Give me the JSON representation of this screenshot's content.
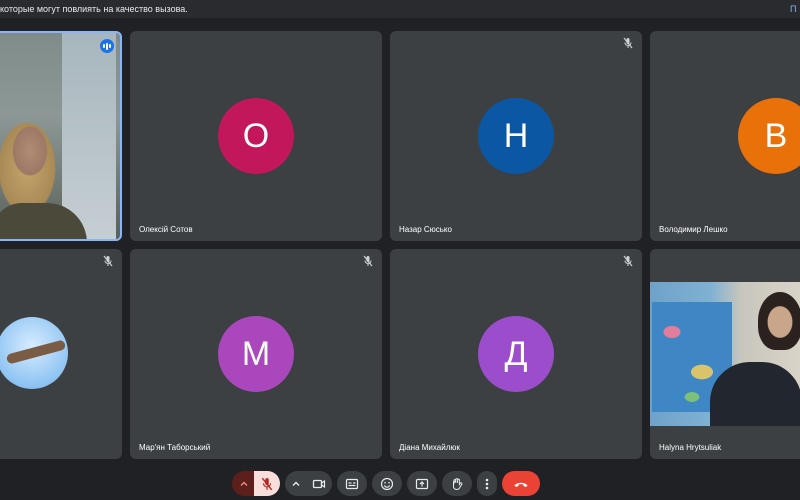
{
  "notification": {
    "text": "которые могут повлиять на качество вызова.",
    "link": "П"
  },
  "participants": [
    {
      "name": "",
      "video": true,
      "speaking": true
    },
    {
      "name": "Олексій Сотов",
      "initial": "О",
      "color": "#c2185b"
    },
    {
      "name": "Назар Сюсько",
      "initial": "Н",
      "color": "#0b57a4",
      "muted": true
    },
    {
      "name": "Володимир Лешко",
      "initial": "В",
      "color": "#e8710a"
    },
    {
      "name": "",
      "muted": true,
      "bird_avatar": true
    },
    {
      "name": "Мар'ян Таборський",
      "initial": "М",
      "color": "#ab47bc",
      "muted": true
    },
    {
      "name": "Діана Михайлюк",
      "initial": "Д",
      "color": "#9c4dcc",
      "muted": true
    },
    {
      "name": "Halyna Hrytsuliak",
      "video": true
    }
  ],
  "controls": [
    {
      "name": "mic-options-chevron",
      "icon": "chevron-up-icon"
    },
    {
      "name": "microphone-toggle",
      "icon": "mic-off-icon",
      "state": "off"
    },
    {
      "name": "camera-options-chevron",
      "icon": "chevron-up-icon"
    },
    {
      "name": "camera-toggle",
      "icon": "video-icon"
    },
    {
      "name": "captions-button",
      "icon": "captions-icon"
    },
    {
      "name": "reactions-button",
      "icon": "emoji-icon"
    },
    {
      "name": "present-button",
      "icon": "present-icon"
    },
    {
      "name": "raise-hand-button",
      "icon": "hand-icon"
    },
    {
      "name": "more-options-button",
      "icon": "more-vert-icon"
    },
    {
      "name": "leave-call-button",
      "icon": "phone-hangup-icon"
    }
  ],
  "colors": {
    "background": "#202124",
    "tile": "#3c4043",
    "accent": "#8ab4f8",
    "danger": "#ea4335",
    "mic_off_bg": "#f9dedc"
  }
}
